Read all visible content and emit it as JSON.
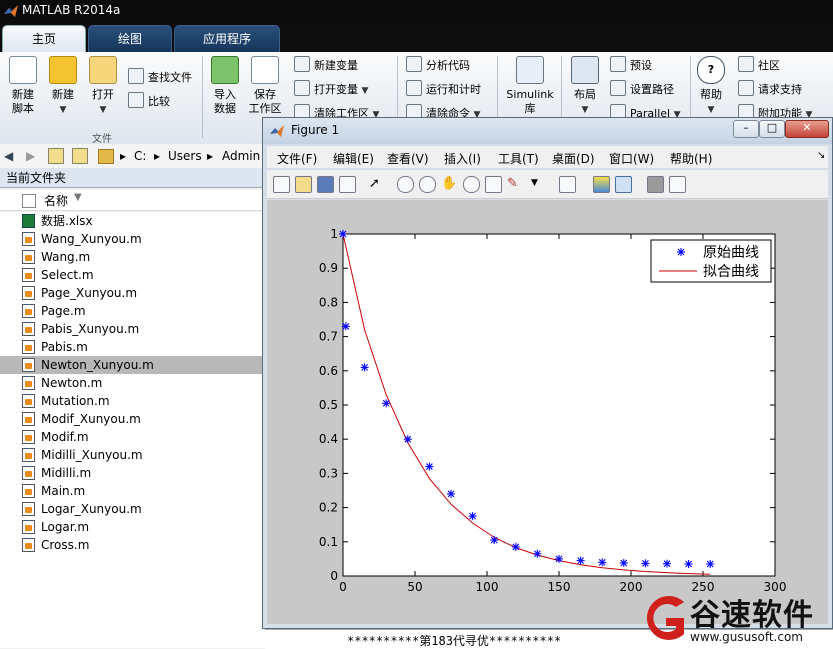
{
  "app": {
    "title": "MATLAB R2014a"
  },
  "tabs": [
    {
      "label": "主页",
      "active": true
    },
    {
      "label": "绘图",
      "active": false
    },
    {
      "label": "应用程序",
      "active": false
    }
  ],
  "ribbon": {
    "new_script": "新建\n脚本",
    "new": "新建",
    "open": "打开",
    "find_files": "查找文件",
    "compare": "比较",
    "file_group": "文件",
    "import_data": "导入\n数据",
    "save_workspace": "保存\n工作区",
    "new_variable": "新建变量",
    "open_variable": "打开变量",
    "clear_workspace": "清除工作区",
    "analyze_code": "分析代码",
    "run_and_time": "运行和计时",
    "clear_commands": "清除命令",
    "simulink": "Simulink\n库",
    "layout": "布局",
    "preferences": "预设",
    "set_path": "设置路径",
    "parallel": "Parallel",
    "help": "帮助",
    "community": "社区",
    "request_support": "请求支持",
    "add_ons": "附加功能"
  },
  "address": {
    "drive": "C:",
    "users": "Users",
    "admin": "Admin"
  },
  "current_folder": {
    "title": "当前文件夹",
    "column_name": "名称",
    "files": [
      {
        "name": "数据.xlsx",
        "type": "xlsx"
      },
      {
        "name": "Wang_Xunyou.m",
        "type": "m"
      },
      {
        "name": "Wang.m",
        "type": "m"
      },
      {
        "name": "Select.m",
        "type": "m"
      },
      {
        "name": "Page_Xunyou.m",
        "type": "m"
      },
      {
        "name": "Page.m",
        "type": "m"
      },
      {
        "name": "Pabis_Xunyou.m",
        "type": "m"
      },
      {
        "name": "Pabis.m",
        "type": "m"
      },
      {
        "name": "Newton_Xunyou.m",
        "type": "m",
        "selected": true
      },
      {
        "name": "Newton.m",
        "type": "m"
      },
      {
        "name": "Mutation.m",
        "type": "m"
      },
      {
        "name": "Modif_Xunyou.m",
        "type": "m"
      },
      {
        "name": "Modif.m",
        "type": "m"
      },
      {
        "name": "Midilli_Xunyou.m",
        "type": "m"
      },
      {
        "name": "Midilli.m",
        "type": "m"
      },
      {
        "name": "Main.m",
        "type": "m"
      },
      {
        "name": "Logar_Xunyou.m",
        "type": "m"
      },
      {
        "name": "Logar.m",
        "type": "m"
      },
      {
        "name": "Cross.m",
        "type": "m"
      }
    ]
  },
  "figure": {
    "title": "Figure 1",
    "menu": [
      "文件(F)",
      "编辑(E)",
      "查看(V)",
      "插入(I)",
      "工具(T)",
      "桌面(D)",
      "窗口(W)",
      "帮助(H)"
    ],
    "window_buttons": {
      "minimize": "–",
      "maximize": "□",
      "close": "✕"
    }
  },
  "chart_data": {
    "type": "scatter",
    "xlim": [
      0,
      300
    ],
    "ylim": [
      0,
      1
    ],
    "xticks": [
      0,
      50,
      100,
      150,
      200,
      250,
      300
    ],
    "yticks": [
      0,
      0.1,
      0.2,
      0.3,
      0.4,
      0.5,
      0.6,
      0.7,
      0.8,
      0.9,
      1
    ],
    "legend_position": "top-right",
    "series": [
      {
        "name": "原始曲线",
        "style": "markers",
        "marker": "*",
        "color": "#0000ff",
        "x": [
          0,
          2,
          15,
          30,
          45,
          60,
          75,
          90,
          105,
          120,
          135,
          150,
          165,
          180,
          195,
          210,
          225,
          240,
          255
        ],
        "y": [
          1.0,
          0.73,
          0.61,
          0.505,
          0.4,
          0.32,
          0.24,
          0.175,
          0.105,
          0.085,
          0.065,
          0.05,
          0.045,
          0.04,
          0.038,
          0.037,
          0.036,
          0.035,
          0.035
        ]
      },
      {
        "name": "拟合曲线",
        "style": "line",
        "color": "#cc0000",
        "x": [
          0,
          15,
          30,
          45,
          60,
          75,
          90,
          105,
          120,
          135,
          150,
          165,
          180,
          195,
          210,
          225,
          240,
          255
        ],
        "y": [
          1.0,
          0.72,
          0.53,
          0.39,
          0.285,
          0.21,
          0.155,
          0.113,
          0.083,
          0.061,
          0.045,
          0.033,
          0.024,
          0.018,
          0.013,
          0.01,
          0.007,
          0.005
        ]
      }
    ]
  },
  "command_window": {
    "line": "**********第183代寻优**********"
  },
  "watermark": {
    "brand": "谷速软件",
    "url": "www.gususoft.com"
  },
  "colors": {
    "accent": "#15355a",
    "selected_row": "#b8b8b8",
    "data_marker": "#0000ff",
    "fit_line": "#cc0000"
  }
}
